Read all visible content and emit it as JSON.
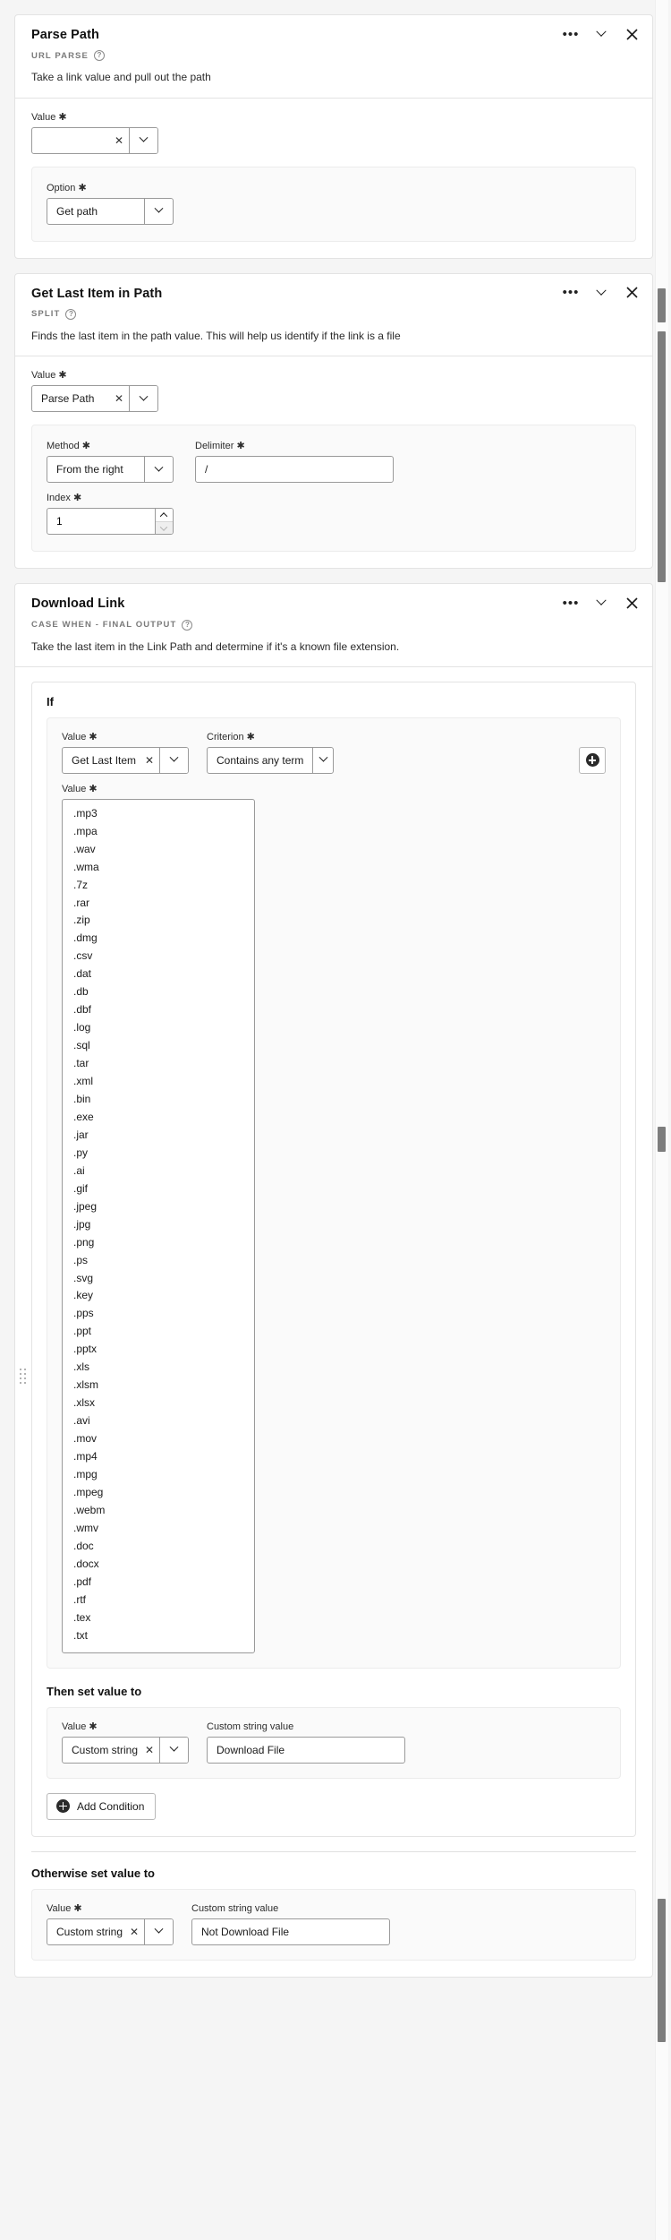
{
  "cards": [
    {
      "title": "Parse Path",
      "type_label": "URL PARSE",
      "description": "Take a link value and pull out the path",
      "value_label": "Value",
      "value_text": "",
      "option_label": "Option",
      "option_value": "Get path"
    },
    {
      "title": "Get Last Item in Path",
      "type_label": "SPLIT",
      "description": "Finds the last item in the path value. This will help us identify if the link is a file",
      "value_label": "Value",
      "value_text": "Parse Path",
      "method_label": "Method",
      "method_value": "From the right",
      "delimiter_label": "Delimiter",
      "delimiter_value": "/",
      "index_label": "Index",
      "index_value": "1"
    },
    {
      "title": "Download Link",
      "type_label": "CASE WHEN - FINAL OUTPUT",
      "description": "Take the last item in the Link Path and determine if it's a known file extension.",
      "if_label": "If",
      "cond_value_label": "Value",
      "cond_value_text": "Get Last Item in Path",
      "criterion_label": "Criterion",
      "criterion_value": "Contains any term",
      "terms_label": "Value",
      "terms": [
        ".mp3",
        ".mpa",
        ".wav",
        ".wma",
        ".7z",
        ".rar",
        ".zip",
        ".dmg",
        ".csv",
        ".dat",
        ".db",
        ".dbf",
        ".log",
        ".sql",
        ".tar",
        ".xml",
        ".bin",
        ".exe",
        ".jar",
        ".py",
        ".ai",
        ".gif",
        ".jpeg",
        ".jpg",
        ".png",
        ".ps",
        ".svg",
        ".key",
        ".pps",
        ".ppt",
        ".pptx",
        ".xls",
        ".xlsm",
        ".xlsx",
        ".avi",
        ".mov",
        ".mp4",
        ".mpg",
        ".mpeg",
        ".webm",
        ".wmv",
        ".doc",
        ".docx",
        ".pdf",
        ".rtf",
        ".tex",
        ".txt"
      ],
      "then_heading": "Then set value to",
      "then_value_label": "Value",
      "then_value_text": "Custom string value",
      "then_custom_label": "Custom string value",
      "then_custom_value": "Download File",
      "add_condition_label": "Add Condition",
      "otherwise_heading": "Otherwise set value to",
      "otherwise_value_label": "Value",
      "otherwise_value_text": "Custom string value",
      "otherwise_custom_label": "Custom string value",
      "otherwise_custom_value": "Not Download File"
    }
  ],
  "icons": {
    "more": "•••",
    "collapse": "chevron-down-icon",
    "close": "✕",
    "clear": "✕",
    "help": "?"
  },
  "required_marker": "✱"
}
